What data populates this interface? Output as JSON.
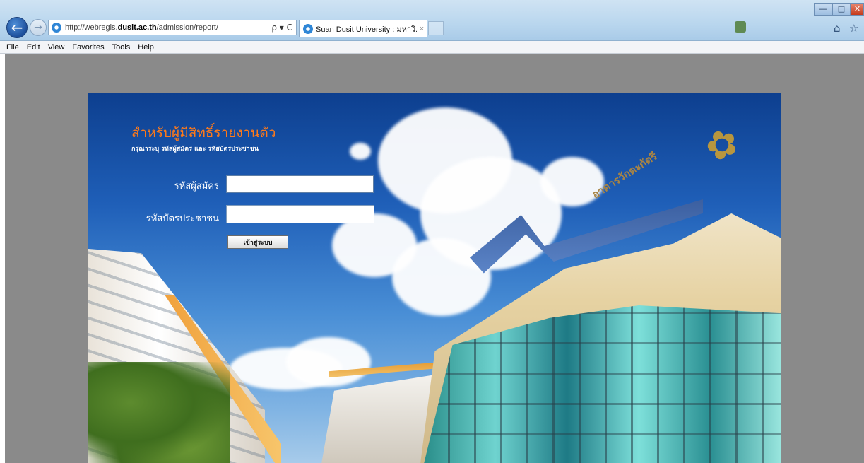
{
  "browser": {
    "address_url_prefix": "http://webregis.",
    "address_url_domain": "dusit.ac.th",
    "address_url_path": "/admission/report/",
    "address_tools": "ρ ▾ C",
    "tab_title": "Suan Dusit University : มหาวิ...",
    "tab_close": "×",
    "menu": [
      "File",
      "Edit",
      "View",
      "Favorites",
      "Tools",
      "Help"
    ],
    "win_min": "—",
    "win_max": "□",
    "win_close": "✕"
  },
  "login": {
    "title": "สำหรับผู้มีสิทธิ์รายงานตัว",
    "subtitle": "กรุณาระบุ รหัสผู้สมัคร และ รหัสบัตรประชาชน",
    "applicant_label": "รหัสผู้สมัคร",
    "applicant_value": "",
    "idcard_label": "รหัสบัตรประชาชน",
    "idcard_value": "",
    "submit_label": "เข้าสู่ระบบ"
  },
  "banner": {
    "building_sign": "อาคารวักตะกัตรี"
  },
  "colors": {
    "title_orange": "#ff7a1a",
    "page_gray": "#8a8a8a",
    "sky_blue": "#1f5fb8"
  }
}
